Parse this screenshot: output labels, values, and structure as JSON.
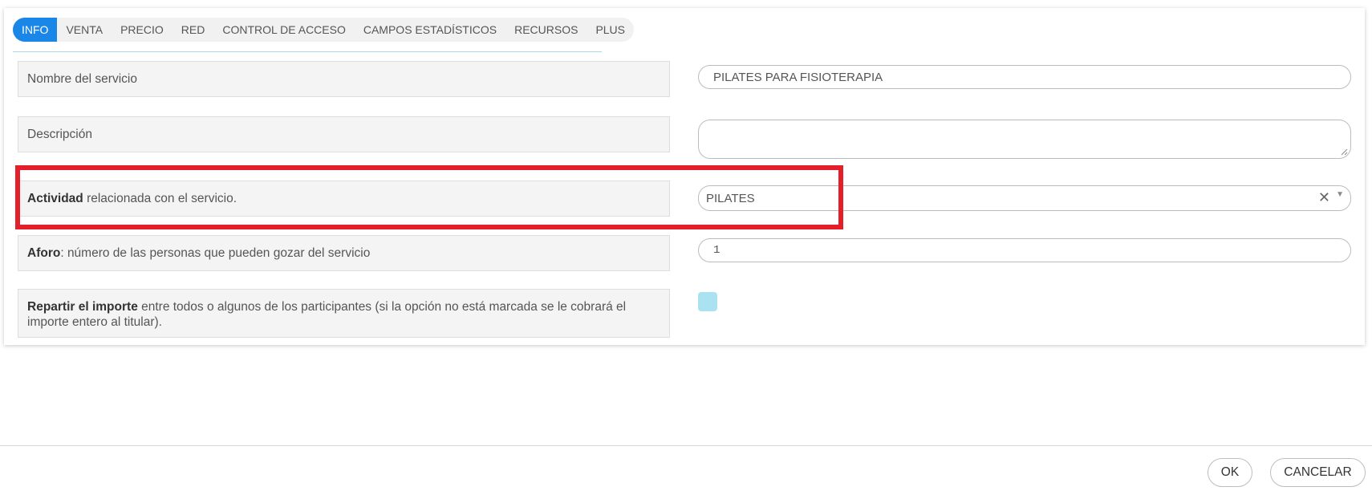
{
  "tabs": [
    {
      "label": "INFO",
      "active": true
    },
    {
      "label": "VENTA"
    },
    {
      "label": "PRECIO"
    },
    {
      "label": "RED"
    },
    {
      "label": "CONTROL DE ACCESO"
    },
    {
      "label": "CAMPOS ESTADÍSTICOS"
    },
    {
      "label": "RECURSOS"
    },
    {
      "label": "PLUS"
    }
  ],
  "fields": {
    "nombre": {
      "label": "Nombre del servicio",
      "value": "PILATES PARA FISIOTERAPIA"
    },
    "descripcion": {
      "label": "Descripción",
      "value": ""
    },
    "actividad": {
      "label_bold": "Actividad",
      "label_rest": " relacionada con el servicio.",
      "value": "PILATES"
    },
    "aforo": {
      "label_bold": "Aforo",
      "label_rest": ": número de las personas que pueden gozar del servicio",
      "value": "1"
    },
    "repartir": {
      "label_bold": "Repartir el importe",
      "label_rest": " entre todos o algunos de los participantes (si la opción no está marcada se le cobrará el importe entero al titular).",
      "checked": false
    }
  },
  "buttons": {
    "ok": "OK",
    "cancel": "CANCELAR"
  },
  "icons": {
    "clear": "close-icon",
    "arrow": "chevron-down-icon"
  },
  "colors": {
    "accent": "#1a86e8",
    "highlight": "#e3202a",
    "checkbox": "#abe2f2"
  }
}
